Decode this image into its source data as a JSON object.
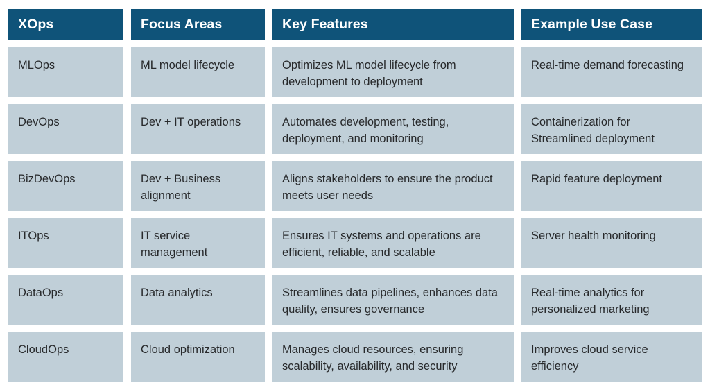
{
  "table": {
    "columns": [
      {
        "key": "xops",
        "label": "XOps"
      },
      {
        "key": "focus_areas",
        "label": "Focus Areas"
      },
      {
        "key": "key_features",
        "label": "Key Features"
      },
      {
        "key": "example_use_case",
        "label": "Example Use Case"
      }
    ],
    "rows": [
      {
        "xops": "MLOps",
        "focus_areas": "ML model lifecycle",
        "key_features": "Optimizes ML model lifecycle from development to deployment",
        "example_use_case": "Real-time demand forecasting"
      },
      {
        "xops": "DevOps",
        "focus_areas": "Dev + IT operations",
        "key_features": "Automates development, testing, deployment, and monitoring",
        "example_use_case": "Containerization for Streamlined deployment"
      },
      {
        "xops": "BizDevOps",
        "focus_areas": "Dev + Business alignment",
        "key_features": "Aligns stakeholders to ensure the product meets user needs",
        "example_use_case": "Rapid feature deployment"
      },
      {
        "xops": "ITOps",
        "focus_areas": "IT service management",
        "key_features": "Ensures IT systems and operations are efficient, reliable, and scalable",
        "example_use_case": "Server health monitoring"
      },
      {
        "xops": "DataOps",
        "focus_areas": "Data analytics",
        "key_features": "Streamlines data pipelines, enhances data quality, ensures governance",
        "example_use_case": "Real-time analytics for personalized marketing"
      },
      {
        "xops": "CloudOps",
        "focus_areas": "Cloud optimization",
        "key_features": "Manages cloud resources, ensuring scalability, availability, and security",
        "example_use_case": "Improves cloud service efficiency"
      }
    ]
  },
  "colors": {
    "header_background": "#0F5379",
    "header_text": "#FFFFFF",
    "cell_background": "#C0CFD8",
    "cell_text": "#27292B",
    "page_background": "#FFFFFF"
  }
}
